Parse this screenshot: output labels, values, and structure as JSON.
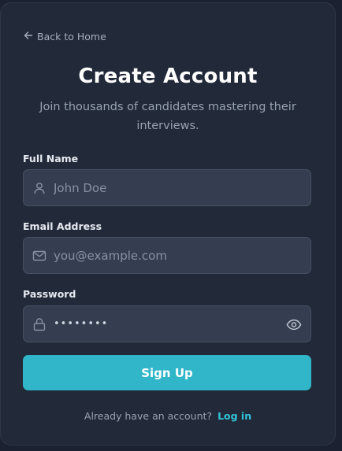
{
  "nav": {
    "back_label": "Back to Home"
  },
  "header": {
    "title": "Create Account",
    "subtitle": "Join thousands of candidates mastering their interviews."
  },
  "form": {
    "full_name": {
      "label": "Full Name",
      "placeholder": "John Doe",
      "value": "",
      "icon": "user-icon"
    },
    "email": {
      "label": "Email Address",
      "placeholder": "you@example.com",
      "value": "",
      "icon": "mail-icon"
    },
    "password": {
      "label": "Password",
      "value": "••••••••",
      "icon": "lock-icon",
      "toggle_icon": "eye-icon"
    },
    "submit_label": "Sign Up"
  },
  "footer": {
    "prompt": "Already have an account?",
    "link_label": "Log in"
  },
  "colors": {
    "background": "#1b2130",
    "card": "#222a3a",
    "input": "#353e50",
    "accent": "#30b6c8",
    "link": "#33c3d6"
  }
}
